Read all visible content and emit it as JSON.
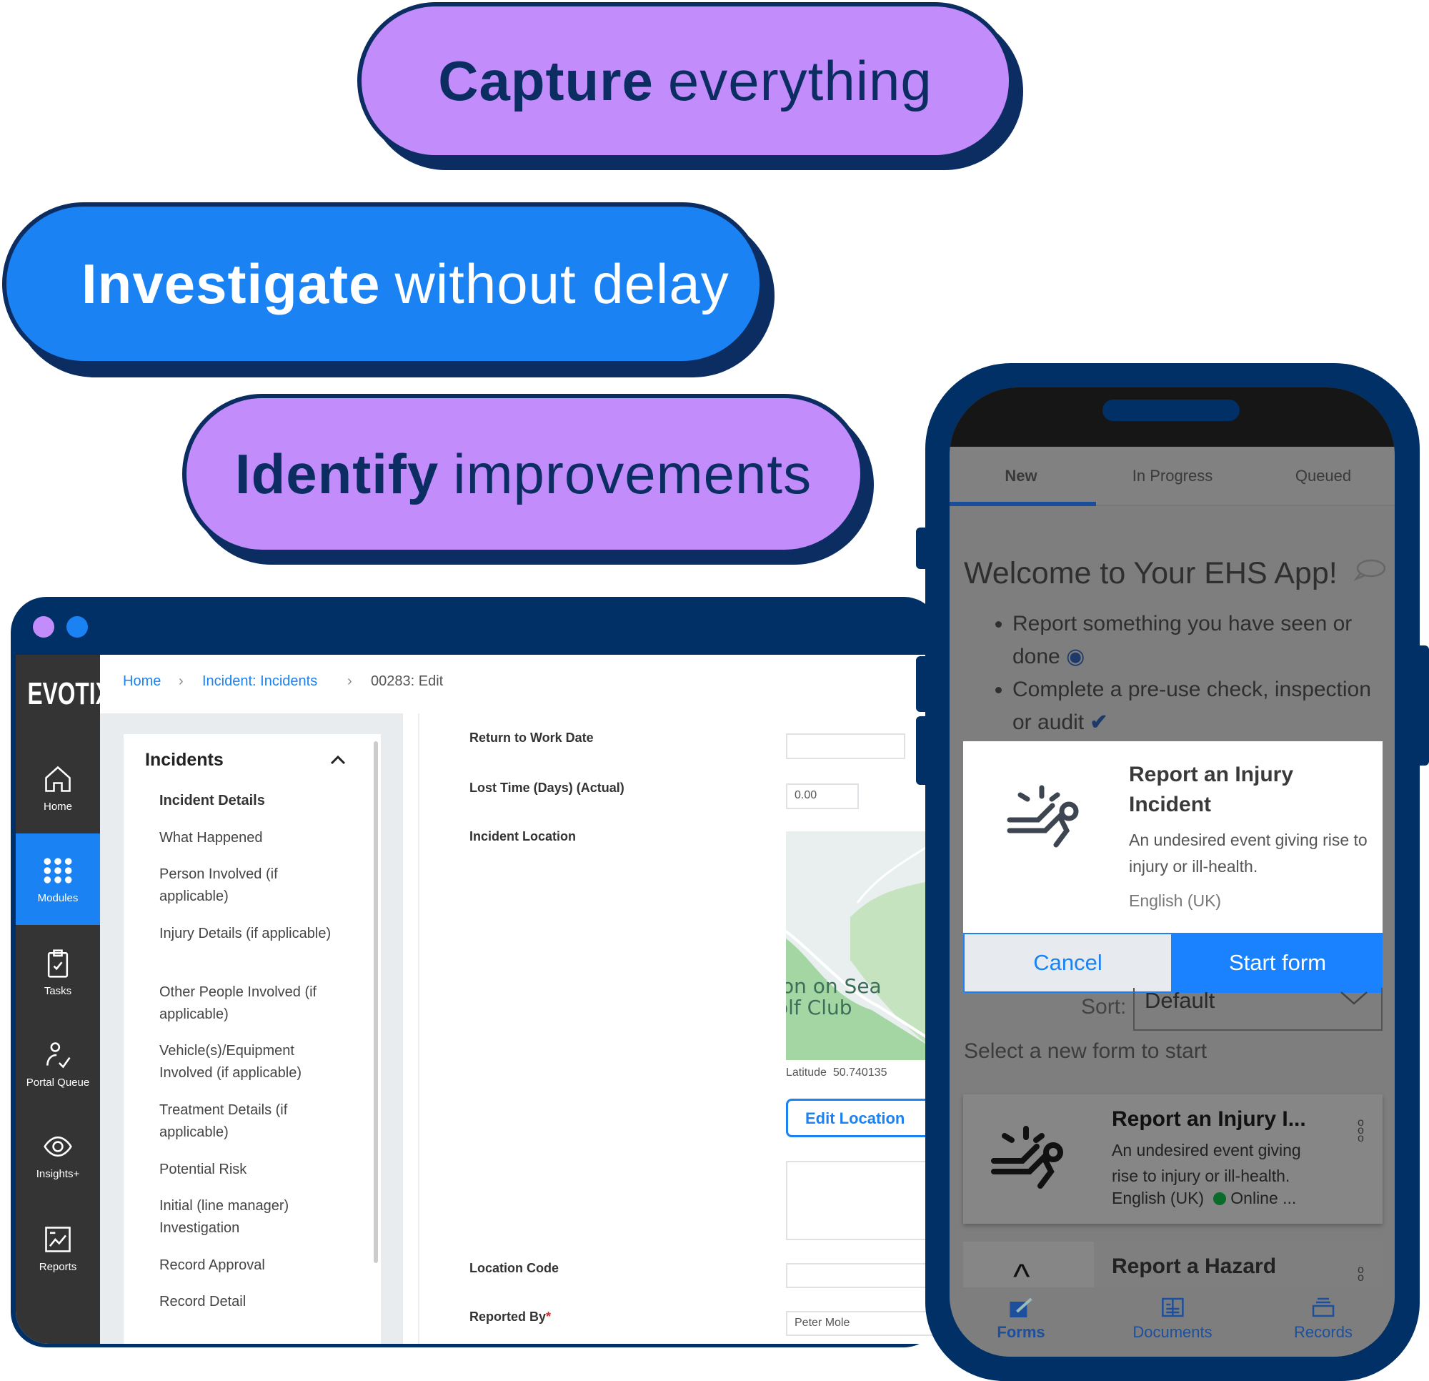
{
  "headlines": [
    {
      "bold": "Capture",
      "rest": "everything"
    },
    {
      "bold": "Investigate",
      "rest": "without delay"
    },
    {
      "bold": "Identify",
      "rest": "improvements"
    }
  ],
  "colors": {
    "navy": "#003066",
    "purple": "#c28cfb",
    "blue": "#1a82f2"
  },
  "desktop": {
    "logo": "EVOTIX",
    "nav": [
      {
        "label": "Home",
        "icon": "home-icon"
      },
      {
        "label": "Modules",
        "icon": "grid-icon",
        "active": true
      },
      {
        "label": "Tasks",
        "icon": "clipboard-check-icon"
      },
      {
        "label": "Portal Queue",
        "icon": "user-check-icon"
      },
      {
        "label": "Insights+",
        "icon": "eye-icon"
      },
      {
        "label": "Reports",
        "icon": "chart-icon"
      }
    ],
    "breadcrumb": [
      "Home",
      "Incident: Incidents",
      "00283: Edit"
    ],
    "section_title": "Incidents",
    "menu": [
      "Incident Details",
      "What Happened",
      "Person Involved (if applicable)",
      "Injury Details (if applicable)",
      "Other People Involved (if applicable)",
      "Vehicle(s)/Equipment Involved (if applicable)",
      "Treatment Details (if applicable)",
      "Potential Risk",
      "Initial (line manager) Investigation",
      "Record Approval",
      "Record Detail"
    ],
    "form": {
      "return_to_work_label": "Return to Work Date",
      "return_to_work_value": "",
      "lost_time_label": "Lost Time (Days) (Actual)",
      "lost_time_value": "0.00",
      "incident_location_label": "Incident Location",
      "map_text_1": "on on Sea",
      "map_text_2": "olf Club",
      "latitude_label": "Latitude",
      "latitude_value": "50.740135",
      "edit_location": "Edit Location",
      "location_code_label": "Location Code",
      "location_code_value": "",
      "reported_by_label": "Reported By",
      "required_mark": "*",
      "reported_by_value": "Peter Mole"
    }
  },
  "mobile": {
    "tabs": [
      "New",
      "In Progress",
      "Queued"
    ],
    "welcome": "Welcome to Your EHS App!",
    "bullets": [
      "Report something you have seen or done",
      "Complete a pre-use check, inspection or audit"
    ],
    "modal": {
      "title": "Report an Injury Incident",
      "desc": "An undesired event giving rise to injury or ill-health.",
      "lang": "English (UK)",
      "cancel": "Cancel",
      "start": "Start form"
    },
    "sort_label": "Sort:",
    "sort_value": "Default",
    "select_text": "Select a new form to start",
    "forms": [
      {
        "title": "Report an Injury I...",
        "desc": "An undesired event giving rise to injury or ill-health.",
        "lang": "English (UK)",
        "status": "Online ..."
      },
      {
        "title": "Report a Hazard"
      }
    ],
    "bottom_nav": [
      {
        "label": "Forms",
        "active": true
      },
      {
        "label": "Documents"
      },
      {
        "label": "Records"
      }
    ]
  }
}
